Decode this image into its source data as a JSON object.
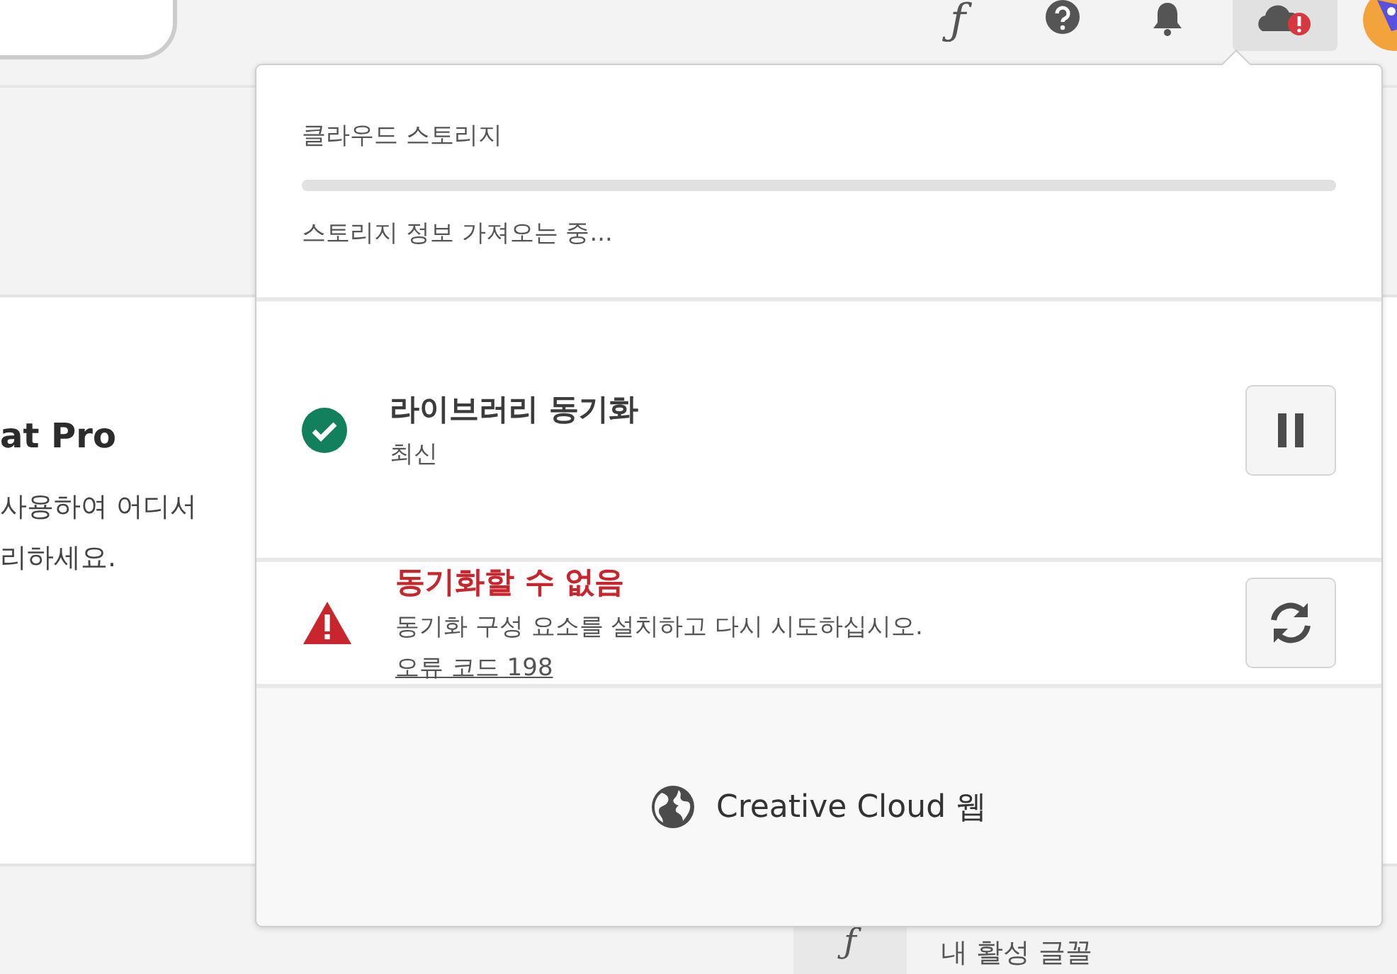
{
  "toolbar": [
    {
      "kind": "fonts",
      "glyph": "ƒ",
      "selected": false
    },
    {
      "kind": "help",
      "selected": false
    },
    {
      "kind": "bell",
      "selected": false
    },
    {
      "kind": "cloud",
      "selected": true,
      "alert": true
    },
    {
      "kind": "avatar"
    }
  ],
  "background_card": {
    "title": "at Pro",
    "lines": [
      "사용하여 어디서",
      "리하세요."
    ]
  },
  "fonts_item": {
    "glyph": "ƒ",
    "label": "내 활성 글꼴"
  },
  "popover": {
    "storage": {
      "title": "클라우드 스토리지",
      "status": "스토리지 정보 가져오는 중..."
    },
    "sync_items": [
      {
        "kind": "ok",
        "title": "라이브러리 동기화",
        "subtitle": "최신"
      },
      {
        "kind": "error",
        "title": "동기화할 수 없음",
        "subtitle": "동기화 구성 요소를 설치하고 다시 시도하십시오.",
        "link": "오류 코드 198"
      }
    ],
    "footer": {
      "label": "Creative Cloud 웹"
    }
  }
}
